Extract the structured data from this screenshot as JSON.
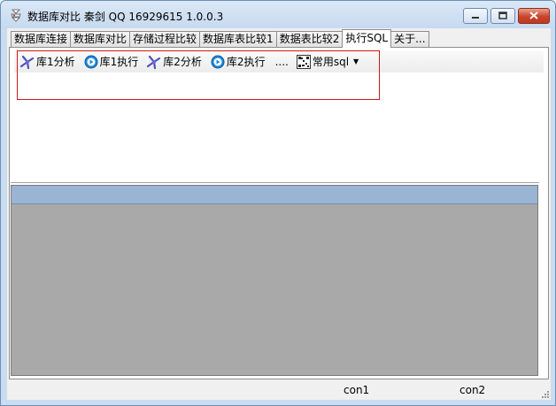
{
  "window": {
    "title": "数据库对比 秦剑 QQ 16929615 1.0.0.3",
    "icons": {
      "app": "database-compare-icon",
      "minimize": "minimize-icon",
      "maximize": "maximize-icon",
      "close": "close-icon"
    }
  },
  "tabs": [
    {
      "label": "数据库连接",
      "active": false
    },
    {
      "label": "数据库对比",
      "active": false
    },
    {
      "label": "存储过程比较",
      "active": false
    },
    {
      "label": "数据库表比较1",
      "active": false
    },
    {
      "label": "数据表比较2",
      "active": false
    },
    {
      "label": "执行SQL",
      "active": true
    },
    {
      "label": "关于...",
      "active": false
    }
  ],
  "toolbar": {
    "items": [
      {
        "label": "库1分析",
        "icon": "analyze-icon"
      },
      {
        "label": "库1执行",
        "icon": "execute-icon"
      },
      {
        "label": "库2分析",
        "icon": "analyze-icon"
      },
      {
        "label": "库2执行",
        "icon": "execute-icon"
      }
    ],
    "more": "....",
    "dropdown": {
      "label": "常用sql",
      "icon": "sql-grid-icon"
    }
  },
  "editor": {
    "value": ""
  },
  "statusbar": {
    "con1": "con1",
    "con2": "con2"
  },
  "colors": {
    "highlight": "#d01818",
    "grid_header": "#9ab4d3",
    "grid_body": "#a9a9a9"
  }
}
